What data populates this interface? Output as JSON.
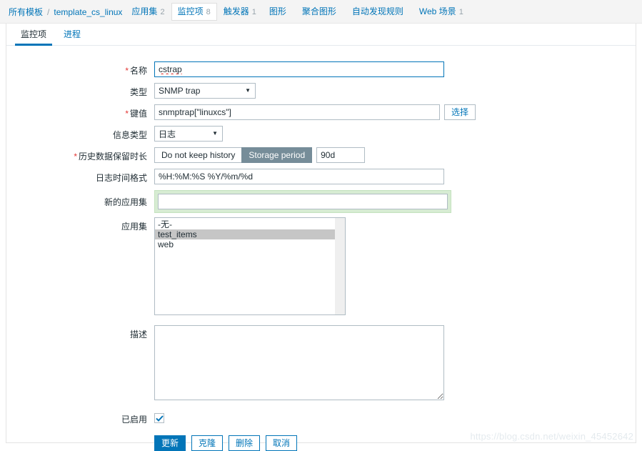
{
  "nav": {
    "breadcrumb": {
      "root": "所有模板",
      "separator": "/",
      "template": "template_cs_linux"
    },
    "items": [
      {
        "label": "应用集",
        "count": "2",
        "current": false
      },
      {
        "label": "监控项",
        "count": "8",
        "current": true
      },
      {
        "label": "触发器",
        "count": "1",
        "current": false
      },
      {
        "label": "图形",
        "count": "",
        "current": false
      },
      {
        "label": "聚合图形",
        "count": "",
        "current": false
      },
      {
        "label": "自动发现规则",
        "count": "",
        "current": false
      },
      {
        "label": "Web 场景",
        "count": "1",
        "current": false
      }
    ]
  },
  "tabs": [
    {
      "label": "监控项",
      "active": true
    },
    {
      "label": "进程",
      "active": false
    }
  ],
  "form": {
    "name": {
      "label": "名称",
      "required": true,
      "value": "cstrap",
      "placeholder": "",
      "focused": true
    },
    "type": {
      "label": "类型",
      "required": false,
      "value": "SNMP trap",
      "options": [
        "SNMP trap"
      ]
    },
    "key": {
      "label": "键值",
      "required": true,
      "value": "snmptrap[\"linuxcs\"]",
      "placeholder": "",
      "select_button": "选择"
    },
    "value_type": {
      "label": "信息类型",
      "required": false,
      "value": "日志",
      "options": [
        "日志"
      ]
    },
    "history": {
      "label": "历史数据保留时长",
      "required": true,
      "options": [
        "Do not keep history",
        "Storage period"
      ],
      "selected": "Storage period",
      "period_value": "90d"
    },
    "log_time_format": {
      "label": "日志时间格式",
      "required": false,
      "value": "%H:%M:%S %Y/%m/%d",
      "placeholder": ""
    },
    "new_application": {
      "label": "新的应用集",
      "required": false,
      "value": "",
      "placeholder": "",
      "highlight_color": "#d7ecd3"
    },
    "applications": {
      "label": "应用集",
      "options": [
        {
          "label": "-无-",
          "selected": false
        },
        {
          "label": "test_items",
          "selected": true
        },
        {
          "label": "web",
          "selected": false
        }
      ]
    },
    "description": {
      "label": "描述",
      "value": "",
      "placeholder": ""
    },
    "enabled": {
      "label": "已启用",
      "checked": true
    }
  },
  "actions": [
    {
      "label": "更新",
      "style": "primary"
    },
    {
      "label": "克隆",
      "style": "outline"
    },
    {
      "label": "删除",
      "style": "outline"
    },
    {
      "label": "取消",
      "style": "outline"
    }
  ],
  "watermark": "https://blog.csdn.net/weixin_45452642",
  "colors": {
    "accent": "#0275b8",
    "required": "#e33734",
    "segment_selected": "#768d99",
    "list_selected": "#c6c6c6",
    "header_bg": "#f4f4f4"
  }
}
